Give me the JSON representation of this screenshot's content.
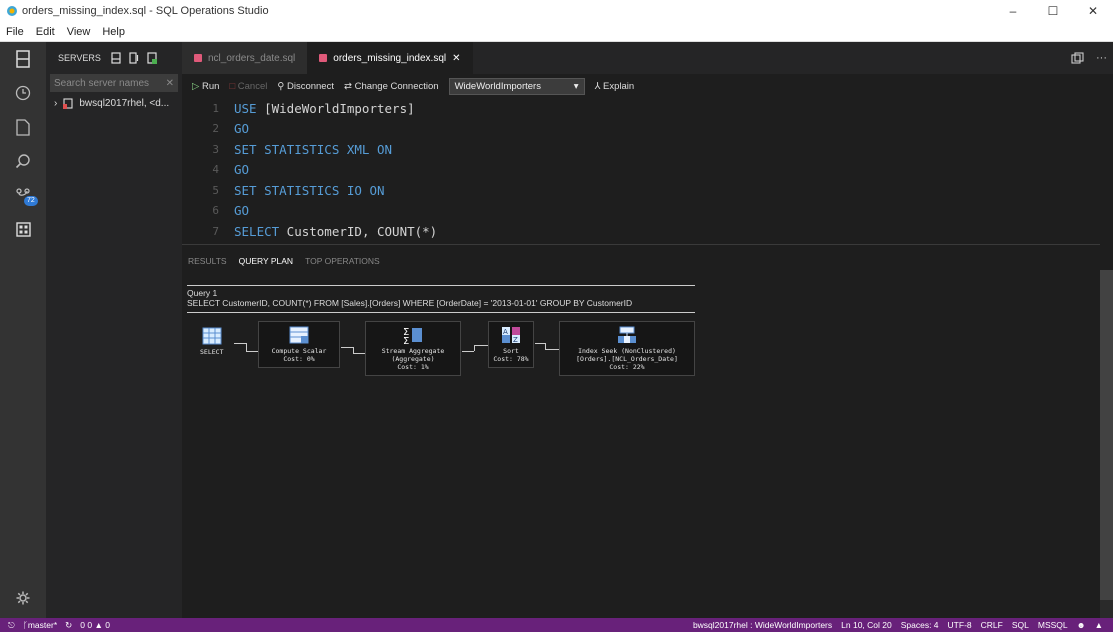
{
  "window": {
    "title": "orders_missing_index.sql - SQL Operations Studio",
    "controls": {
      "minimize": "–",
      "maximize": "☐",
      "close": "✕"
    }
  },
  "menu": [
    "File",
    "Edit",
    "View",
    "Help"
  ],
  "activity_bar": {
    "scm_badge": "72"
  },
  "sidebar": {
    "header": "SERVERS",
    "search_placeholder": "Search server names",
    "clear_glyph": "✕",
    "server": "bwsql2017rhel, <d..."
  },
  "tabs": [
    {
      "label": "ncl_orders_date.sql",
      "active": false
    },
    {
      "label": "orders_missing_index.sql",
      "active": true,
      "close": "✕"
    }
  ],
  "tab_actions": {
    "more": "···"
  },
  "toolbar": {
    "run": "Run",
    "cancel": "Cancel",
    "disconnect": "Disconnect",
    "change_connection": "Change Connection",
    "database": "WideWorldImporters",
    "explain": "Explain"
  },
  "editor": {
    "lines": [
      {
        "n": "1",
        "kw": "USE",
        "rest": " [WideWorldImporters]"
      },
      {
        "n": "2",
        "kw": "GO",
        "rest": ""
      },
      {
        "n": "3",
        "kw": "SET STATISTICS XML ON",
        "rest": ""
      },
      {
        "n": "4",
        "kw": "GO",
        "rest": ""
      },
      {
        "n": "5",
        "kw": "SET STATISTICS IO ON",
        "rest": ""
      },
      {
        "n": "6",
        "kw": "GO",
        "rest": ""
      },
      {
        "n": "7",
        "kw": "SELECT",
        "rest": " CustomerID, COUNT(*)"
      }
    ]
  },
  "results": {
    "tabs": [
      "RESULTS",
      "QUERY PLAN",
      "TOP OPERATIONS"
    ],
    "active_tab": "QUERY PLAN",
    "query_title": "Query 1",
    "query_text": "SELECT CustomerID, COUNT(*) FROM [Sales].[Orders] WHERE [OrderDate] = '2013-01-01' GROUP BY CustomerID",
    "plan": {
      "select": "SELECT",
      "compute_scalar": {
        "name": "Compute Scalar",
        "cost": "Cost: 0%"
      },
      "stream_aggregate": {
        "name": "Stream Aggregate",
        "sub": "(Aggregate)",
        "cost": "Cost: 1%"
      },
      "sort": {
        "name": "Sort",
        "cost": "Cost: 78%"
      },
      "index_seek": {
        "name": "Index Seek (NonClustered)",
        "sub": "[Orders].[NCL_Orders_Date]",
        "cost": "Cost: 22%"
      }
    }
  },
  "statusbar": {
    "branch": "master*",
    "problems": "0 0 ▲ 0",
    "connection": "bwsql2017rhel : WideWorldImporters",
    "position": "Ln 10, Col 20",
    "spaces": "Spaces: 4",
    "encoding": "UTF-8",
    "eol": "CRLF",
    "language": "SQL",
    "provider": "MSSQL"
  }
}
